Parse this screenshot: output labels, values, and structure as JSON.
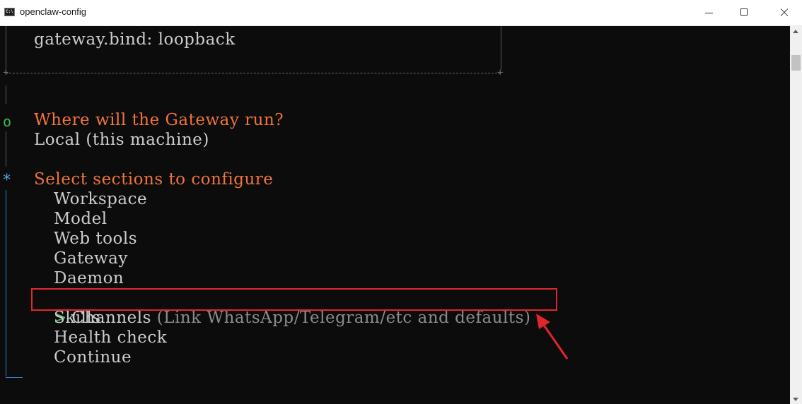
{
  "window": {
    "title": "openclaw-config",
    "app_icon_text": "C:\\"
  },
  "terminal": {
    "gateway_bind": "gateway.bind: loopback",
    "question_marker": "o",
    "question": "Where will the Gateway run?",
    "answer": "Local (this machine)",
    "sections_marker": "*",
    "sections_prompt": "Select sections to configure",
    "options": [
      {
        "label": "Workspace"
      },
      {
        "label": "Model"
      },
      {
        "label": "Web tools"
      },
      {
        "label": "Gateway"
      },
      {
        "label": "Daemon"
      },
      {
        "label": "Channels",
        "hint": "(Link WhatsApp/Telegram/etc and defaults)",
        "selected": true,
        "pointer": ">"
      },
      {
        "label": "Skills"
      },
      {
        "label": "Health check"
      },
      {
        "label": "Continue"
      }
    ]
  },
  "colors": {
    "prompt": "#f0733c",
    "text": "#cccccc",
    "done_marker": "#3fb950",
    "active_marker": "#4aa3df",
    "highlight": "#e0262c"
  }
}
